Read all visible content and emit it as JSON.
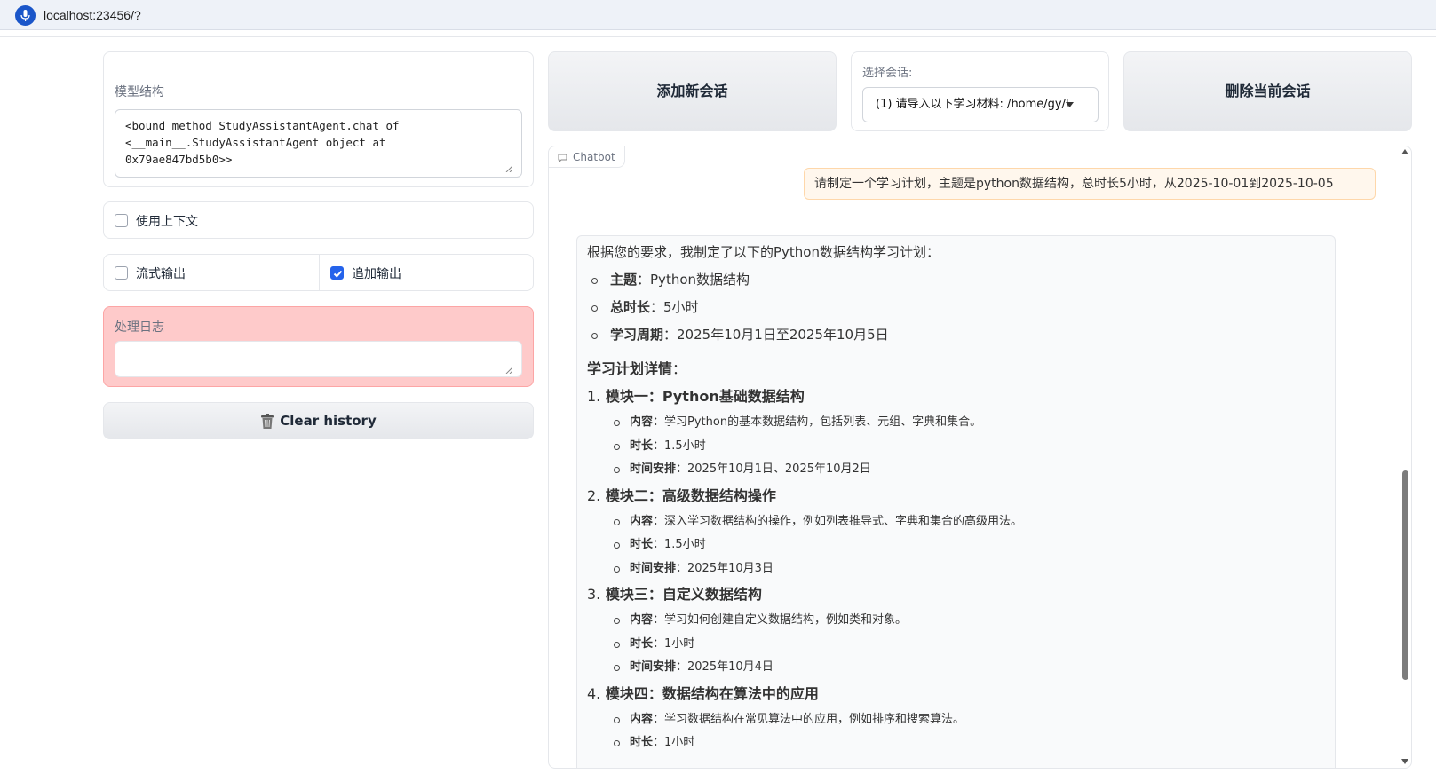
{
  "browser": {
    "url": "localhost:23456/?"
  },
  "left": {
    "model_label": "模型结构",
    "model_value": "<bound method StudyAssistantAgent.chat of\n<__main__.StudyAssistantAgent object at\n0x79ae847bd5b0>>",
    "use_context_label": "使用上下文",
    "use_context_checked": false,
    "stream_label": "流式输出",
    "stream_checked": false,
    "append_label": "追加输出",
    "append_checked": true,
    "log_label": "处理日志",
    "log_value": "",
    "clear_label": "Clear history"
  },
  "top": {
    "add_label": "添加新会话",
    "session_label": "选择会话:",
    "session_value": "(1) 请导入以下学习材料: /home/gy/l",
    "delete_label": "删除当前会话"
  },
  "chat": {
    "tag": "Chatbot",
    "user_message": "请制定一个学习计划，主题是python数据结构，总时长5小时，从2025-10-01到2025-10-05",
    "intro": "根据您的要求，我制定了以下的Python数据结构学习计划：",
    "summary": [
      {
        "key": "主题",
        "value": "：Python数据结构"
      },
      {
        "key": "总时长",
        "value": "：5小时"
      },
      {
        "key": "学习周期",
        "value": "：2025年10月1日至2025年10月5日"
      }
    ],
    "plan_title": "学习计划详情",
    "plan_colon": "：",
    "modules": [
      {
        "num": "1.",
        "title": "模块一：Python基础数据结构",
        "items": [
          {
            "key": "内容",
            "value": "：学习Python的基本数据结构，包括列表、元组、字典和集合。"
          },
          {
            "key": "时长",
            "value": "：1.5小时"
          },
          {
            "key": "时间安排",
            "value": "：2025年10月1日、2025年10月2日"
          }
        ]
      },
      {
        "num": "2.",
        "title": "模块二：高级数据结构操作",
        "items": [
          {
            "key": "内容",
            "value": "：深入学习数据结构的操作，例如列表推导式、字典和集合的高级用法。"
          },
          {
            "key": "时长",
            "value": "：1.5小时"
          },
          {
            "key": "时间安排",
            "value": "：2025年10月3日"
          }
        ]
      },
      {
        "num": "3.",
        "title": "模块三：自定义数据结构",
        "items": [
          {
            "key": "内容",
            "value": "：学习如何创建自定义数据结构，例如类和对象。"
          },
          {
            "key": "时长",
            "value": "：1小时"
          },
          {
            "key": "时间安排",
            "value": "：2025年10月4日"
          }
        ]
      },
      {
        "num": "4.",
        "title": "模块四：数据结构在算法中的应用",
        "items": [
          {
            "key": "内容",
            "value": "：学习数据结构在常见算法中的应用，例如排序和搜索算法。"
          },
          {
            "key": "时长",
            "value": "：1小时"
          }
        ]
      }
    ]
  },
  "colors": {
    "accent": "#2563eb",
    "log_bg": "#fecaca",
    "user_bubble": "#fff7ed"
  }
}
